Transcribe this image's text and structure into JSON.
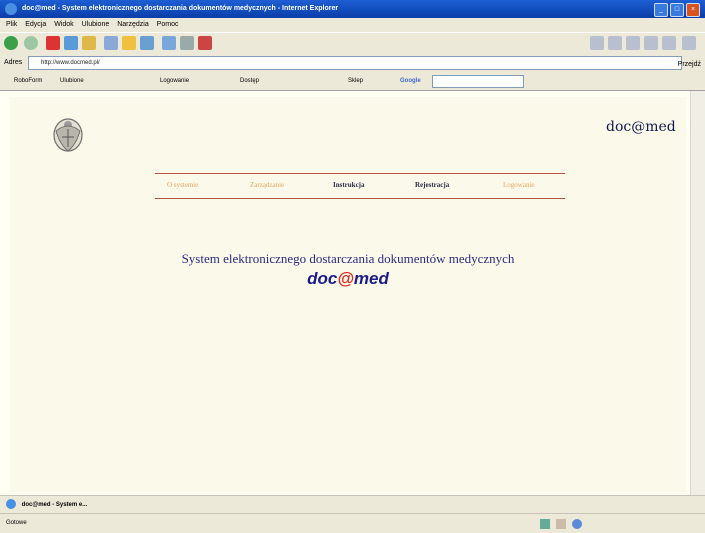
{
  "window": {
    "title": "doc@med - System elektronicznego dostarczania dokumentów medycznych - Internet Explorer"
  },
  "menu": [
    "Plik",
    "Edycja",
    "Widok",
    "Ulubione",
    "Narzędzia",
    "Pomoc"
  ],
  "address": {
    "label": "Adres",
    "url": "http://www.docmed.pl/",
    "go_label": "Przejdź"
  },
  "links": {
    "items": [
      "RoboForm",
      "Ulubione",
      "Logowanie",
      "Dostęp",
      "Sklep",
      "Google"
    ]
  },
  "page": {
    "logo_text": "doc@med",
    "nav": [
      {
        "label": "O systemie",
        "active": false
      },
      {
        "label": "Zarządzanie",
        "active": false
      },
      {
        "label": "Instrukcja",
        "active": true
      },
      {
        "label": "Rejestracja",
        "active": true
      },
      {
        "label": "Logowanie",
        "active": false
      }
    ],
    "system_text": "System elektronicznego dostarczania dokumentów medycznych",
    "brand_pre": "doc",
    "brand_at": "@",
    "brand_post": "med"
  },
  "taskbar": {
    "item": "doc@med - System e..."
  },
  "status": {
    "text": "Gotowe"
  },
  "colors": {
    "accent_red": "#e4271f",
    "brand_blue": "#1c1c8a",
    "nav_line": "#b05040"
  }
}
